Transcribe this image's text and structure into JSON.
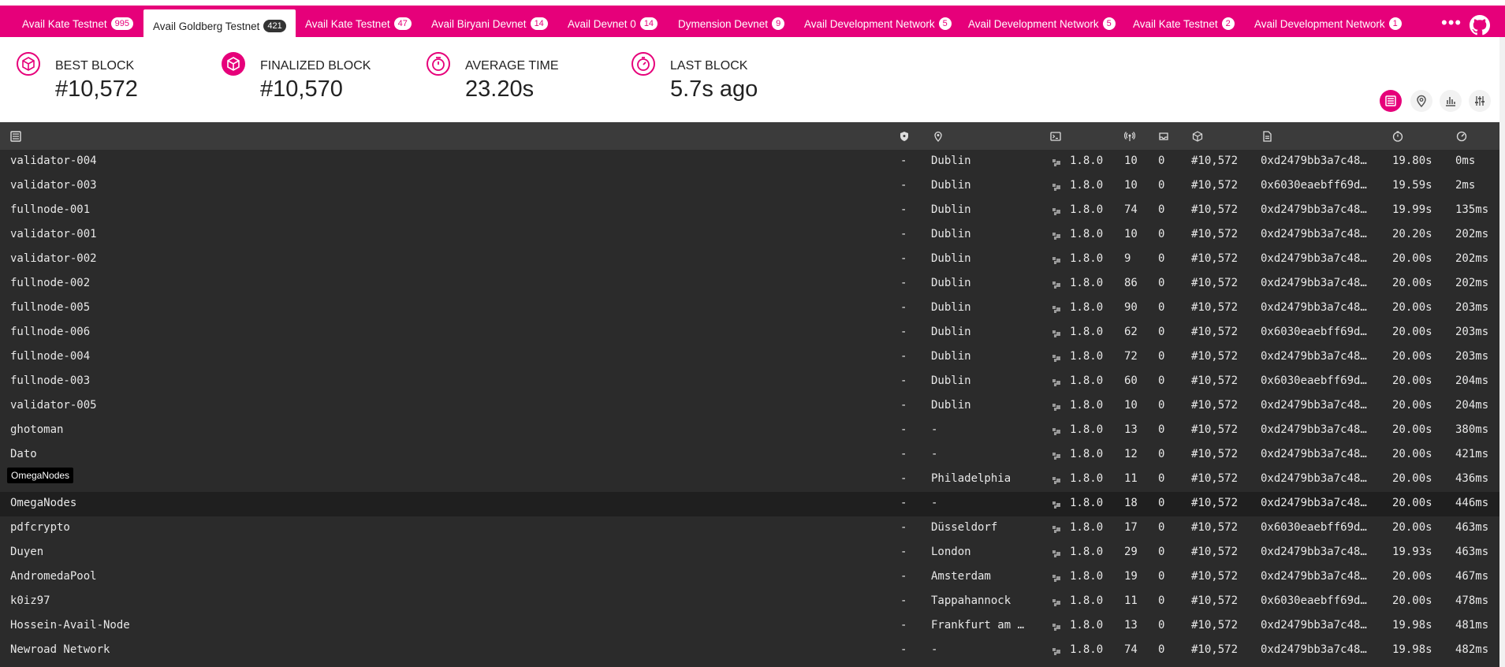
{
  "tabs": [
    {
      "label": "Avail Kate Testnet",
      "count": "995",
      "active": false
    },
    {
      "label": "Avail Goldberg Testnet",
      "count": "421",
      "active": true
    },
    {
      "label": "Avail Kate Testnet",
      "count": "47",
      "active": false
    },
    {
      "label": "Avail Biryani Devnet",
      "count": "14",
      "active": false
    },
    {
      "label": "Avail Devnet 0",
      "count": "14",
      "active": false
    },
    {
      "label": "Dymension Devnet",
      "count": "9",
      "active": false
    },
    {
      "label": "Avail Development Network",
      "count": "5",
      "active": false
    },
    {
      "label": "Avail Development Network",
      "count": "5",
      "active": false
    },
    {
      "label": "Avail Kate Testnet",
      "count": "2",
      "active": false
    },
    {
      "label": "Avail Development Network",
      "count": "1",
      "active": false
    }
  ],
  "more_label": "•••",
  "stats": {
    "best_block": {
      "label": "BEST BLOCK",
      "value": "#10,572"
    },
    "finalized_block": {
      "label": "FINALIZED BLOCK",
      "value": "#10,570"
    },
    "average_time": {
      "label": "AVERAGE TIME",
      "value": "23.20s"
    },
    "last_block": {
      "label": "LAST BLOCK",
      "value": "5.7s ago"
    }
  },
  "view_buttons": [
    "list-view-icon",
    "map-view-icon",
    "stats-view-icon",
    "settings-icon"
  ],
  "table": {
    "header_icons": [
      "node-list-icon",
      "validator-shield-icon",
      "location-pin-icon",
      "terminal-icon",
      "peers-icon",
      "tx-inbox-icon",
      "block-cube-icon",
      "block-hash-icon",
      "block-time-icon",
      "propagation-icon"
    ],
    "tooltip": "OmegaNodes",
    "rows": [
      {
        "name": "validator-004",
        "validator": "-",
        "location": "Dublin",
        "version": "1.8.0",
        "peers": "10",
        "txs": "0",
        "block": "#10,572",
        "hash": "0xd2479bb3a7c48…",
        "time": "19.80s",
        "prop": "0ms"
      },
      {
        "name": "validator-003",
        "validator": "-",
        "location": "Dublin",
        "version": "1.8.0",
        "peers": "10",
        "txs": "0",
        "block": "#10,572",
        "hash": "0x6030eaebff69d…",
        "time": "19.59s",
        "prop": "2ms"
      },
      {
        "name": "fullnode-001",
        "validator": "-",
        "location": "Dublin",
        "version": "1.8.0",
        "peers": "74",
        "txs": "0",
        "block": "#10,572",
        "hash": "0xd2479bb3a7c48…",
        "time": "19.99s",
        "prop": "135ms"
      },
      {
        "name": "validator-001",
        "validator": "-",
        "location": "Dublin",
        "version": "1.8.0",
        "peers": "10",
        "txs": "0",
        "block": "#10,572",
        "hash": "0xd2479bb3a7c48…",
        "time": "20.20s",
        "prop": "202ms"
      },
      {
        "name": "validator-002",
        "validator": "-",
        "location": "Dublin",
        "version": "1.8.0",
        "peers": "9",
        "txs": "0",
        "block": "#10,572",
        "hash": "0xd2479bb3a7c48…",
        "time": "20.00s",
        "prop": "202ms"
      },
      {
        "name": "fullnode-002",
        "validator": "-",
        "location": "Dublin",
        "version": "1.8.0",
        "peers": "86",
        "txs": "0",
        "block": "#10,572",
        "hash": "0xd2479bb3a7c48…",
        "time": "20.00s",
        "prop": "202ms"
      },
      {
        "name": "fullnode-005",
        "validator": "-",
        "location": "Dublin",
        "version": "1.8.0",
        "peers": "90",
        "txs": "0",
        "block": "#10,572",
        "hash": "0xd2479bb3a7c48…",
        "time": "20.00s",
        "prop": "203ms"
      },
      {
        "name": "fullnode-006",
        "validator": "-",
        "location": "Dublin",
        "version": "1.8.0",
        "peers": "62",
        "txs": "0",
        "block": "#10,572",
        "hash": "0x6030eaebff69d…",
        "time": "20.00s",
        "prop": "203ms"
      },
      {
        "name": "fullnode-004",
        "validator": "-",
        "location": "Dublin",
        "version": "1.8.0",
        "peers": "72",
        "txs": "0",
        "block": "#10,572",
        "hash": "0xd2479bb3a7c48…",
        "time": "20.00s",
        "prop": "203ms"
      },
      {
        "name": "fullnode-003",
        "validator": "-",
        "location": "Dublin",
        "version": "1.8.0",
        "peers": "60",
        "txs": "0",
        "block": "#10,572",
        "hash": "0x6030eaebff69d…",
        "time": "20.00s",
        "prop": "204ms"
      },
      {
        "name": "validator-005",
        "validator": "-",
        "location": "Dublin",
        "version": "1.8.0",
        "peers": "10",
        "txs": "0",
        "block": "#10,572",
        "hash": "0xd2479bb3a7c48…",
        "time": "20.00s",
        "prop": "204ms"
      },
      {
        "name": "ghotoman",
        "validator": "-",
        "location": "-",
        "version": "1.8.0",
        "peers": "13",
        "txs": "0",
        "block": "#10,572",
        "hash": "0xd2479bb3a7c48…",
        "time": "20.00s",
        "prop": "380ms"
      },
      {
        "name": "Dato",
        "validator": "-",
        "location": "-",
        "version": "1.8.0",
        "peers": "12",
        "txs": "0",
        "block": "#10,572",
        "hash": "0xd2479bb3a7c48…",
        "time": "20.00s",
        "prop": "421ms"
      },
      {
        "name": "",
        "validator": "-",
        "location": "Philadelphia",
        "version": "1.8.0",
        "peers": "11",
        "txs": "0",
        "block": "#10,572",
        "hash": "0xd2479bb3a7c48…",
        "time": "20.00s",
        "prop": "436ms"
      },
      {
        "name": "OmegaNodes",
        "validator": "-",
        "location": "-",
        "version": "1.8.0",
        "peers": "18",
        "txs": "0",
        "block": "#10,572",
        "hash": "0xd2479bb3a7c48…",
        "time": "20.00s",
        "prop": "446ms"
      },
      {
        "name": "pdfcrypto",
        "validator": "-",
        "location": "Düsseldorf",
        "version": "1.8.0",
        "peers": "17",
        "txs": "0",
        "block": "#10,572",
        "hash": "0x6030eaebff69d…",
        "time": "20.00s",
        "prop": "463ms"
      },
      {
        "name": "Duyen",
        "validator": "-",
        "location": "London",
        "version": "1.8.0",
        "peers": "29",
        "txs": "0",
        "block": "#10,572",
        "hash": "0xd2479bb3a7c48…",
        "time": "19.93s",
        "prop": "463ms"
      },
      {
        "name": "AndromedaPool",
        "validator": "-",
        "location": "Amsterdam",
        "version": "1.8.0",
        "peers": "19",
        "txs": "0",
        "block": "#10,572",
        "hash": "0xd2479bb3a7c48…",
        "time": "20.00s",
        "prop": "467ms"
      },
      {
        "name": "k0iz97",
        "validator": "-",
        "location": "Tappahannock",
        "version": "1.8.0",
        "peers": "11",
        "txs": "0",
        "block": "#10,572",
        "hash": "0x6030eaebff69d…",
        "time": "20.00s",
        "prop": "478ms"
      },
      {
        "name": "Hossein-Avail-Node",
        "validator": "-",
        "location": "Frankfurt am …",
        "version": "1.8.0",
        "peers": "13",
        "txs": "0",
        "block": "#10,572",
        "hash": "0xd2479bb3a7c48…",
        "time": "19.98s",
        "prop": "481ms"
      },
      {
        "name": "Newroad Network",
        "validator": "-",
        "location": "-",
        "version": "1.8.0",
        "peers": "74",
        "txs": "0",
        "block": "#10,572",
        "hash": "0xd2479bb3a7c48…",
        "time": "19.98s",
        "prop": "482ms"
      }
    ]
  },
  "colors": {
    "accent": "#e6007a",
    "table_bg": "#2b2b2b",
    "header_bg": "#3b3b3b",
    "highlight_row": "#1f1f1f"
  }
}
